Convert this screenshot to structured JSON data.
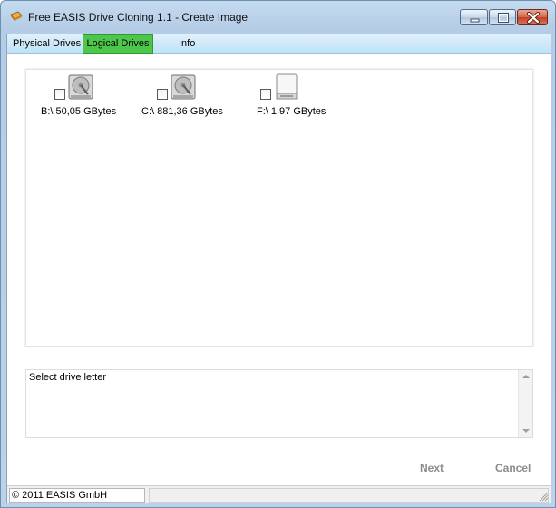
{
  "window": {
    "title": "Free EASIS Drive Cloning 1.1 - Create Image",
    "accent": "#4cc74c"
  },
  "tabs": [
    {
      "label": "Physical Drives",
      "active": false
    },
    {
      "label": "Logical Drives",
      "active": true
    },
    {
      "label": "Info",
      "active": false
    }
  ],
  "drives": [
    {
      "label": "B:\\ 50,05 GBytes",
      "icon": "hard-disk-icon",
      "checked": false
    },
    {
      "label": "C:\\ 881,36 GBytes",
      "icon": "hard-disk-icon",
      "checked": false
    },
    {
      "label": "F:\\ 1,97 GBytes",
      "icon": "removable-drive-icon",
      "checked": false
    }
  ],
  "log": {
    "text": "Select drive letter"
  },
  "buttons": {
    "next": "Next",
    "cancel": "Cancel"
  },
  "status": {
    "copyright": "© 2011 EASIS GmbH"
  }
}
